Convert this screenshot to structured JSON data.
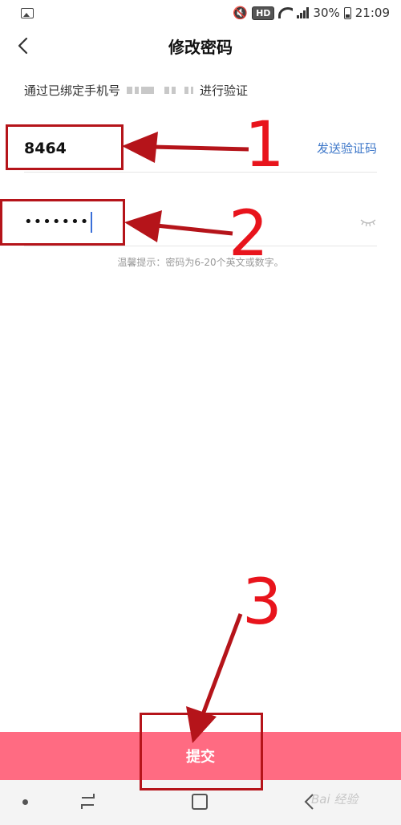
{
  "status_bar": {
    "hd": "HD",
    "battery": "30%",
    "time": "21:09",
    "mute_icon": "🔇"
  },
  "header": {
    "title": "修改密码"
  },
  "verify": {
    "prefix": "通过已绑定手机号",
    "suffix": "进行验证"
  },
  "code_field": {
    "value": "8464",
    "send_label": "发送验证码"
  },
  "password_field": {
    "value": "•••••••"
  },
  "tip": "温馨提示：密码为6-20个英文或数字。",
  "submit": {
    "label": "提交"
  },
  "annotations": {
    "step1": "1",
    "step2": "2",
    "step3": "3"
  },
  "watermark": "Bai 经验",
  "colors": {
    "accent": "#ff6b82",
    "link": "#3f78c9",
    "annotation": "#b5141a"
  }
}
